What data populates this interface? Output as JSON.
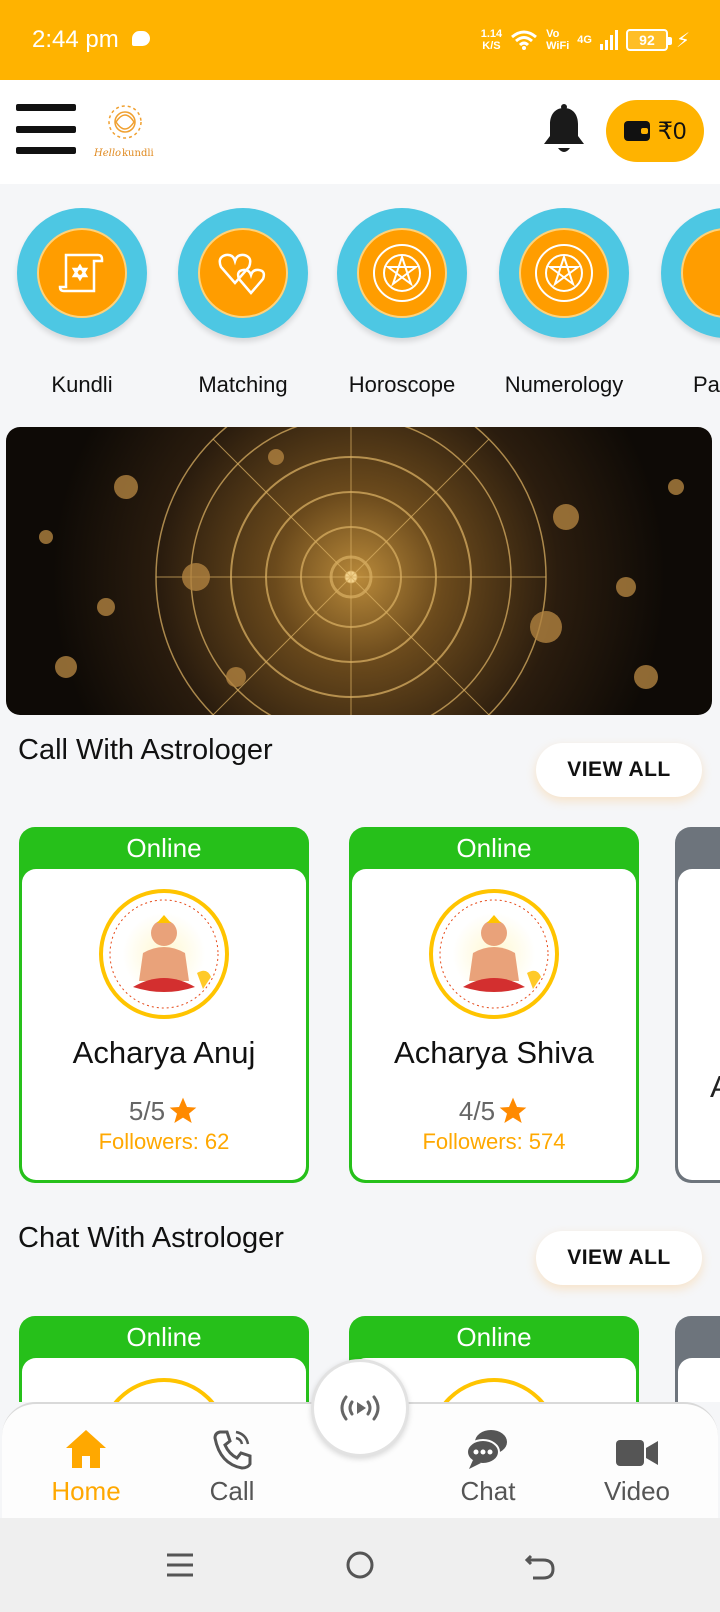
{
  "status_bar": {
    "time": "2:44 pm",
    "speed_value": "1.14",
    "speed_unit": "K/S",
    "vo": "Vo",
    "wifi": "WiFi",
    "network": "4G",
    "battery": "92"
  },
  "header": {
    "logo_icon": "hello-kundli-logo",
    "wallet_balance": "₹0"
  },
  "categories": [
    {
      "label": "Kundli",
      "icon": "scroll-icon"
    },
    {
      "label": "Matching",
      "icon": "hearts-icon"
    },
    {
      "label": "Horoscope",
      "icon": "zodiac-wheel-icon"
    },
    {
      "label": "Numerology",
      "icon": "zodiac-wheel-icon"
    },
    {
      "label": "Pa",
      "icon": "partial-icon"
    }
  ],
  "call_section": {
    "title": "Call With Astrologer",
    "view_all": "VIEW ALL",
    "astrologers": [
      {
        "status": "Online",
        "name": "Acharya Anuj",
        "rating": "5/5",
        "followers": "Followers: 62"
      },
      {
        "status": "Online",
        "name": "Acharya Shiva",
        "rating": "4/5",
        "followers": "Followers: 574"
      }
    ],
    "peek_initial": "A"
  },
  "chat_section": {
    "title": "Chat With Astrologer",
    "view_all": "VIEW ALL",
    "astrologers": [
      {
        "status": "Online"
      },
      {
        "status": "Online"
      }
    ]
  },
  "bottom_nav": {
    "home": "Home",
    "call": "Call",
    "chat": "Chat",
    "video": "Video"
  },
  "colors": {
    "accent": "#ffb300",
    "online_green": "#26c01a",
    "category_blue": "#4dc7e3",
    "category_orange": "#ff9d00"
  }
}
